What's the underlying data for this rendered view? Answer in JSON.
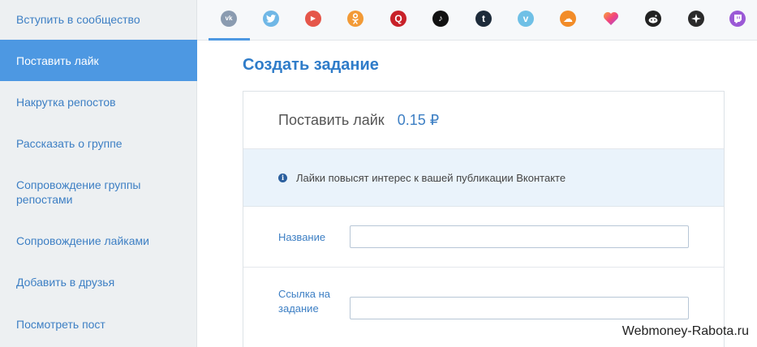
{
  "sidebar": {
    "items": [
      {
        "label": "Вступить в сообщество",
        "active": false
      },
      {
        "label": "Поставить лайк",
        "active": true
      },
      {
        "label": "Накрутка репостов",
        "active": false
      },
      {
        "label": "Рассказать о группе",
        "active": false
      },
      {
        "label": "Сопровождение группы репостами",
        "active": false
      },
      {
        "label": "Сопровождение лайками",
        "active": false
      },
      {
        "label": "Добавить в друзья",
        "active": false
      },
      {
        "label": "Посмотреть пост",
        "active": false
      }
    ]
  },
  "social_tabs": [
    {
      "icon": "vk-icon",
      "glyph": "vk",
      "color": "#8a9bb0",
      "selected": true
    },
    {
      "icon": "twitter-icon",
      "glyph": "t",
      "color": "#6fb7e6",
      "selected": false
    },
    {
      "icon": "youtube-icon",
      "glyph": "▶",
      "color": "#e5564a",
      "selected": false
    },
    {
      "icon": "odnoklassniki-icon",
      "glyph": "ok",
      "color": "#f29a36",
      "selected": false
    },
    {
      "icon": "quora-icon",
      "glyph": "Q",
      "color": "#c82129",
      "selected": false
    },
    {
      "icon": "tiktok-icon",
      "glyph": "♪",
      "color": "#111111",
      "selected": false
    },
    {
      "icon": "tumblr-icon",
      "glyph": "t",
      "color": "#1d2b3a",
      "selected": false
    },
    {
      "icon": "vimeo-icon",
      "glyph": "v",
      "color": "#6fc0e6",
      "selected": false
    },
    {
      "icon": "soundcloud-icon",
      "glyph": "☁",
      "color": "#f28c28",
      "selected": false
    },
    {
      "icon": "likee-icon",
      "glyph": "♥",
      "color": "#f34f7a",
      "selected": false
    },
    {
      "icon": "reddit-icon",
      "glyph": "r",
      "color": "#222222",
      "selected": false
    },
    {
      "icon": "compass-icon",
      "glyph": "✦",
      "color": "#2a2a2a",
      "selected": false
    },
    {
      "icon": "twitch-icon",
      "glyph": "▣",
      "color": "#9b59d6",
      "selected": false
    }
  ],
  "main": {
    "title": "Создать задание",
    "task_name": "Поставить лайк",
    "task_price": "0.15 ₽",
    "info_icon": "info-icon",
    "info_text": "Лайки повысят интерес к вашей публикации Вконтакте",
    "fields": {
      "name_label": "Название",
      "name_value": "",
      "link_label": "Ссылка на задание",
      "link_value": ""
    }
  },
  "watermark": "Webmoney-Rabota.ru",
  "colors": {
    "accent": "#4d98e2",
    "link": "#3d7fc4",
    "sidebar_bg": "#edf0f2",
    "info_bg": "#eaf3fb"
  }
}
